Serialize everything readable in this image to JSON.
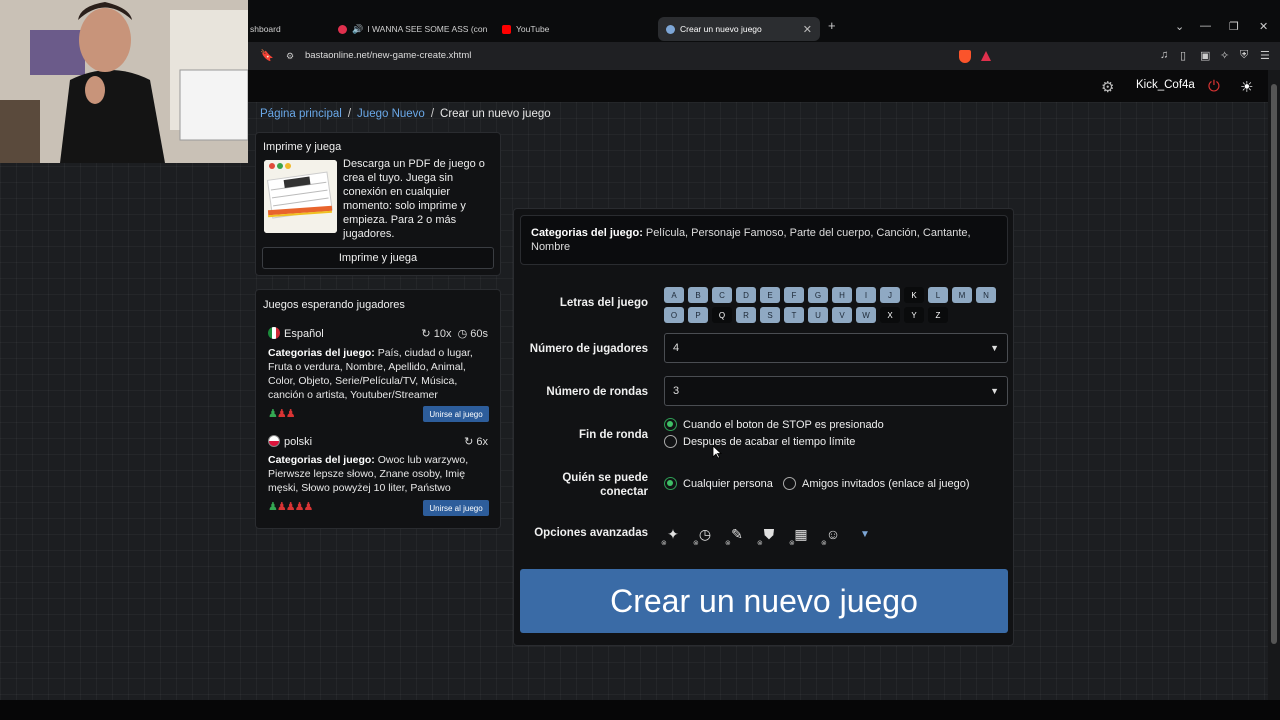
{
  "browser": {
    "tabs": [
      {
        "label": "shboard",
        "active": false
      },
      {
        "label": "I WANNA SEE SOME ASS (con Jet",
        "active": false
      },
      {
        "label": "YouTube",
        "active": false
      },
      {
        "label": "Crear un nuevo juego",
        "active": true
      }
    ],
    "new_tab": "+",
    "url": "bastaonline.net/new-game-create.xhtml"
  },
  "header": {
    "username": "Kick_Cof4a"
  },
  "breadcrumb": {
    "home": "Página principal",
    "sep1": "/",
    "middle": "Juego Nuevo",
    "sep2": "/",
    "current": "Crear un nuevo juego"
  },
  "print_card": {
    "title": "Imprime y juega",
    "description": "Descarga un PDF de juego o crea el tuyo. Juega sin conexión en cualquier momento: solo imprime y empieza. Para 2 o más jugadores.",
    "button": "Imprime y juega"
  },
  "waiting": {
    "title": "Juegos esperando jugadores",
    "games": [
      {
        "language": "Español",
        "rounds": "10x",
        "time": "60s",
        "cats_label": "Categorias del juego:",
        "categories": "País, ciudad o lugar, Fruta o verdura, Nombre, Apellido, Animal, Color, Objeto, Serie/Película/TV, Música, canción o artista, Youtuber/Streamer",
        "players_green": 1,
        "players_red": 2,
        "join": "Unirse al juego"
      },
      {
        "language": "polski",
        "rounds": "6x",
        "cats_label": "Categorias del juego:",
        "categories": "Owoc lub warzywo, Pierwsze lepsze słowo, Znane osoby, Imię męski, Słowo powyżej 10 liter, Państwo",
        "players_green": 1,
        "players_red": 4,
        "join": "Unirse al juego"
      }
    ]
  },
  "form": {
    "cats_label": "Categorias del juego:",
    "categories": "Película, Personaje Famoso, Parte del cuerpo, Canción, Cantante, Nombre",
    "letters_label": "Letras del juego",
    "letters": [
      {
        "l": "A",
        "on": true
      },
      {
        "l": "B",
        "on": true
      },
      {
        "l": "C",
        "on": true
      },
      {
        "l": "D",
        "on": true
      },
      {
        "l": "E",
        "on": true
      },
      {
        "l": "F",
        "on": true
      },
      {
        "l": "G",
        "on": true
      },
      {
        "l": "H",
        "on": true
      },
      {
        "l": "I",
        "on": true
      },
      {
        "l": "J",
        "on": true
      },
      {
        "l": "K",
        "on": false
      },
      {
        "l": "L",
        "on": true
      },
      {
        "l": "M",
        "on": true
      },
      {
        "l": "N",
        "on": true
      },
      {
        "l": "O",
        "on": true
      },
      {
        "l": "P",
        "on": true
      },
      {
        "l": "Q",
        "on": false
      },
      {
        "l": "R",
        "on": true
      },
      {
        "l": "S",
        "on": true
      },
      {
        "l": "T",
        "on": true
      },
      {
        "l": "U",
        "on": true
      },
      {
        "l": "V",
        "on": true
      },
      {
        "l": "W",
        "on": true
      },
      {
        "l": "X",
        "on": false
      },
      {
        "l": "Y",
        "on": false
      },
      {
        "l": "Z",
        "on": false
      }
    ],
    "players_label": "Número de jugadores",
    "players_value": "4",
    "rounds_label": "Número de rondas",
    "rounds_value": "3",
    "end_label": "Fin de ronda",
    "end_options": [
      "Cuando el boton de STOP es presionado",
      "Despues de acabar el tiempo límite"
    ],
    "end_selected": 0,
    "who_label_1": "Quién se puede",
    "who_label_2": "conectar",
    "who_options": [
      "Cualquier persona",
      "Amigos invitados (enlace al juego)"
    ],
    "who_selected": 0,
    "advanced_label": "Opciones avanzadas",
    "advanced_icons": [
      "sparkles-icon",
      "clock-icon",
      "edit-list-icon",
      "shield-icon",
      "calendar-icon",
      "user-check-icon"
    ],
    "create_button": "Crear un nuevo juego"
  },
  "colors": {
    "accent": "#3a6ba6",
    "link": "#6aa8e8",
    "letter_on": "#8fa9c3",
    "radio_checked": "#3fbf66"
  }
}
